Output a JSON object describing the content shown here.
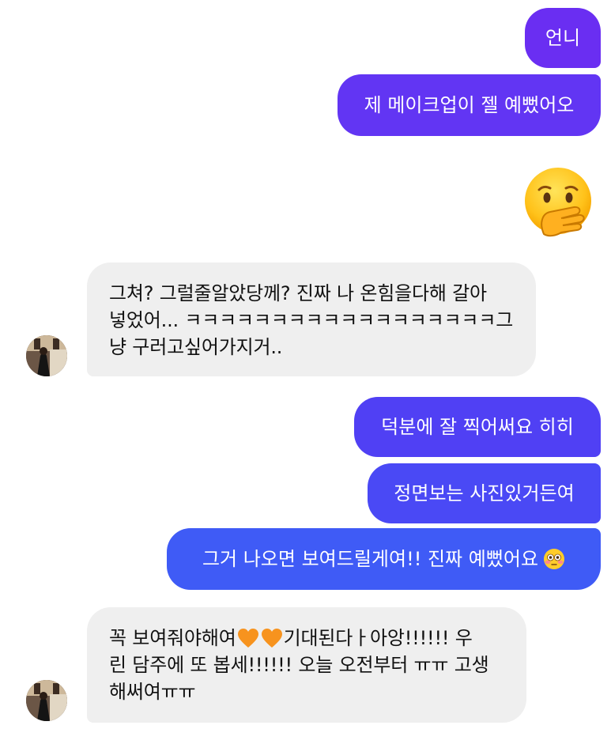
{
  "messages": {
    "m1": "언니",
    "m2": "제 메이크업이 젤 예뻤어오",
    "m3_emoji": "hand-over-mouth-emoji",
    "m4_line1": "그쳐? 그럴줄알았당께? 진짜 나 온힘을다해 갈아",
    "m4_line2": "넣었어... ㅋㅋㅋㅋㅋㅋㅋㅋㅋㅋㅋㅋㅋㅋㅋㅋㅋㅋ그",
    "m4_line3": "냥 구러고싶어가지거..",
    "m5": "덕분에 잘 찍어써요 히히",
    "m6": "정면보는 사진있거든여",
    "m7": "그거 나오면 보여드릴게여!! 진짜 예뻤어요",
    "m7_emoji": "flushed-face-emoji",
    "m8_a": "꼭 보여줘야해여",
    "m8_heart": "orange-heart-emoji",
    "m8_b": "기대된다ㅏ아앙!!!!!! 우",
    "m8_line2": "린 담주에 또 봅세!!!!!! 오늘 오전부터 ㅠㅠ 고생",
    "m8_line3": "해써여ㅠㅠ"
  },
  "colors": {
    "outgoing_top": "#6a2ef2",
    "outgoing_mid": "#5339f5",
    "outgoing_bottom": "#3f5bf6",
    "incoming_bg": "#efefef",
    "incoming_text": "#111111",
    "heart": "#f7931e"
  }
}
